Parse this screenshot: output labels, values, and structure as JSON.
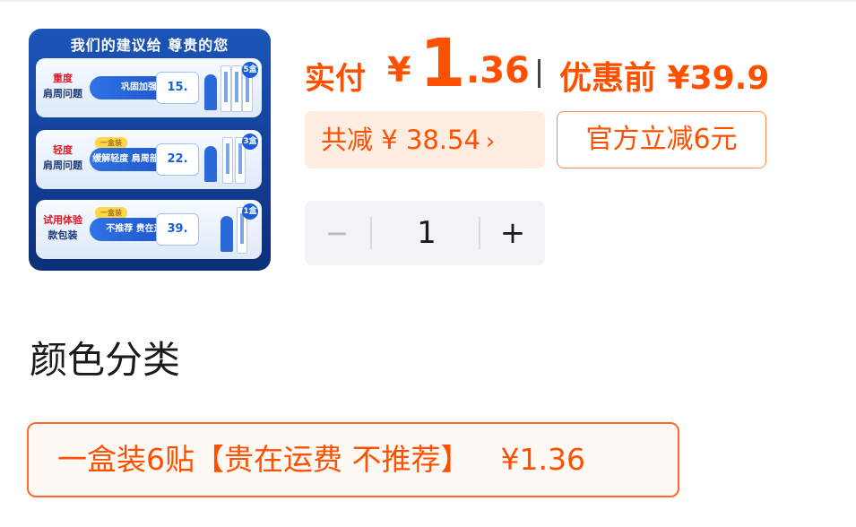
{
  "thumbnail": {
    "title": "我们的建议给 尊贵的您",
    "cards": [
      {
        "label_red": "重度",
        "label": "肩周问题",
        "tag": "",
        "bubble": "巩固加强",
        "price": "15.",
        "badge": "5盒"
      },
      {
        "label_red": "轻度",
        "label": "肩周问题",
        "tag": "一盒装",
        "bubble": "缓解轻度 肩周部位不适",
        "price": "22.",
        "badge": "3盒"
      },
      {
        "label_red": "试用体验",
        "label": "款包装",
        "tag": "一盒装",
        "bubble": "不推荐 贵在运费",
        "price": "39.",
        "badge": "1盒"
      }
    ]
  },
  "price": {
    "pay_label": "实付",
    "yen": "¥",
    "pay_int": "1",
    "pay_dec": ".36",
    "before_label": "优惠前 ¥39.9"
  },
  "discount": {
    "saved_text": "共减 ¥ 38.54",
    "arrow": "›",
    "official_text": "官方立减6元"
  },
  "quantity": {
    "minus": "−",
    "value": "1",
    "plus": "+"
  },
  "section": {
    "title": "颜色分类"
  },
  "option": {
    "label": "一盒装6贴【贵在运费 不推荐】",
    "price": "¥1.36"
  },
  "colors": {
    "accent": "#ff5000",
    "accent_bg": "#ffede2",
    "stepper_bg": "#f1f3f6",
    "thumb_blue": "#1c55b8"
  }
}
